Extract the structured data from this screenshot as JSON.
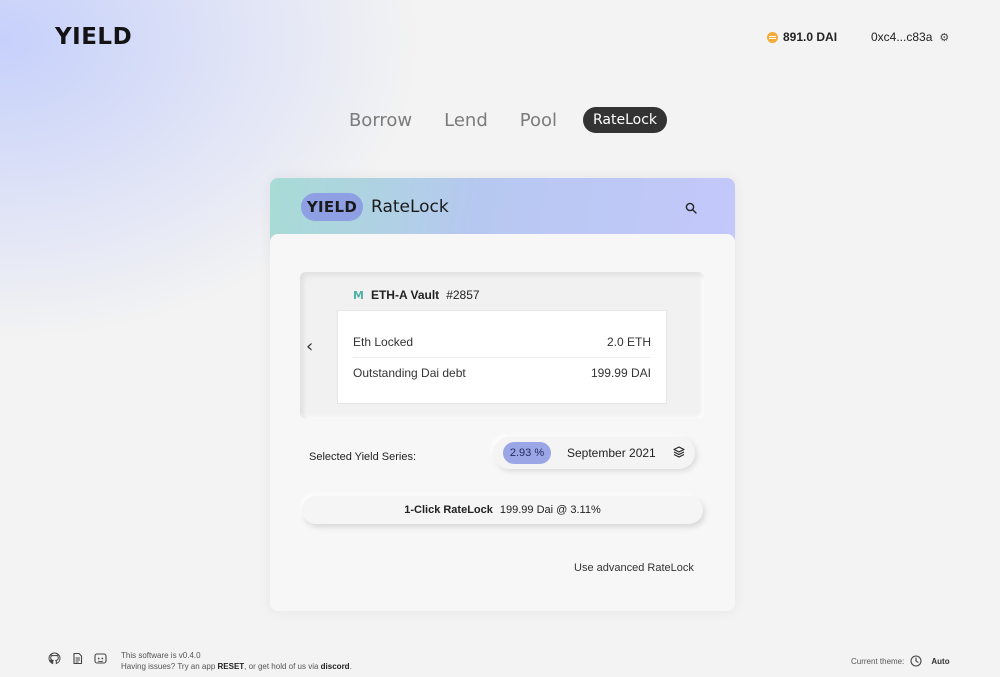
{
  "header": {
    "logo": "YIELD",
    "balance": "891.0 DAI",
    "account": "0xc4...c83a",
    "coin_color": "#f5ac37"
  },
  "nav": {
    "items": [
      {
        "label": "Borrow",
        "active": false
      },
      {
        "label": "Lend",
        "active": false
      },
      {
        "label": "Pool",
        "active": false
      },
      {
        "label": "RateLock",
        "active": true
      }
    ]
  },
  "card": {
    "logo": "YIELD",
    "title": "RateLock",
    "vault": {
      "name": "ETH-A Vault",
      "id": "#2857",
      "rows": [
        {
          "label": "Eth Locked",
          "value": "2.0 ETH"
        },
        {
          "label": "Outstanding Dai debt",
          "value": "199.99 DAI"
        }
      ]
    },
    "series": {
      "label": "Selected Yield Series:",
      "apr": "2.93 %",
      "date": "September 2021"
    },
    "action": {
      "label": "1-Click RateLock",
      "detail": "199.99 Dai @ 3.11%"
    },
    "advanced_link": "Use advanced RateLock"
  },
  "footer": {
    "version_line": "This software is v0.4.0",
    "issues_prefix": "Having issues? Try an app ",
    "issues_reset": "RESET",
    "issues_middle": ", or get hold of us via ",
    "issues_discord": "discord",
    "issues_suffix": ".",
    "theme_label": "Current theme:",
    "theme_value": "Auto"
  },
  "icons": {
    "footer": [
      "github-icon",
      "docs-icon",
      "discord-icon"
    ]
  }
}
